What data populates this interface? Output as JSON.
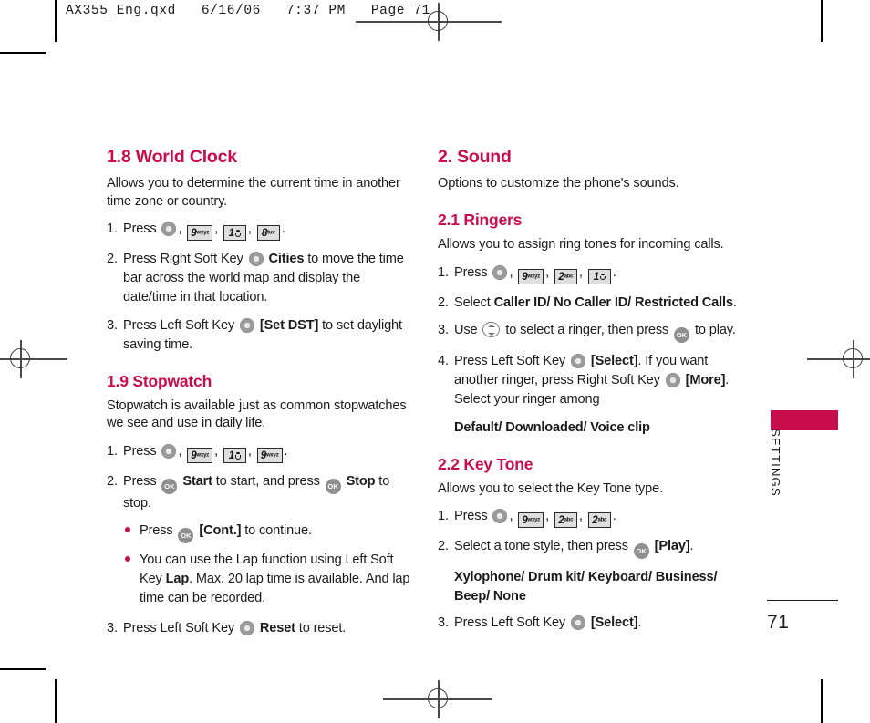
{
  "file_header": "AX355_Eng.qxd   6/16/06   7:37 PM   Page 71",
  "accent_color": "#C90C4C",
  "sidebar": {
    "tab_label": "SETTINGS",
    "page_number": "71"
  },
  "left_column": {
    "section_1_8": {
      "heading": "1.8 World Clock",
      "intro": "Allows you to determine the current time in another time zone or country.",
      "steps": [
        {
          "num": "1.",
          "pre": "Press",
          "keys": [
            "soft-key-circle",
            "9wxyz",
            "1",
            "8tuv"
          ],
          "post": "."
        },
        {
          "num": "2.",
          "pre": "Press Right Soft Key",
          "key": "soft-key-circle",
          "bold": "Cities",
          "post": "to move the time bar across the world map and display the date/time in that location."
        },
        {
          "num": "3.",
          "pre": "Press Left Soft Key",
          "key": "soft-key-circle",
          "bold": "[Set DST]",
          "post": "to set daylight saving time."
        }
      ]
    },
    "section_1_9": {
      "heading": "1.9 Stopwatch",
      "intro": "Stopwatch is available just as common stopwatches we see and use in daily life.",
      "step1": {
        "num": "1.",
        "pre": "Press",
        "post": "."
      },
      "step2": {
        "num": "2.",
        "pre": "Press",
        "bold1": "Start",
        "mid": "to start, and press",
        "bold2": "Stop",
        "post": "to stop."
      },
      "bullets": [
        {
          "pre": "Press",
          "bold": "[Cont.]",
          "post": "to continue."
        },
        {
          "pre": "You can use the Lap function using Left Soft Key",
          "bold": "Lap",
          "post": ". Max. 20 lap time is available. And lap time can be recorded."
        }
      ],
      "step3": {
        "num": "3.",
        "pre": "Press Left Soft Key",
        "bold": "Reset",
        "post": "to reset."
      }
    }
  },
  "right_column": {
    "section_2": {
      "heading": "2. Sound",
      "intro": "Options to customize the phone's sounds."
    },
    "section_2_1": {
      "heading": "2.1 Ringers",
      "intro": "Allows you to assign ring tones for incoming calls.",
      "step1": {
        "num": "1.",
        "pre": "Press",
        "post": "."
      },
      "step2": {
        "num": "2.",
        "pre": "Select",
        "bold": "Caller ID/ No Caller ID/ Restricted Calls",
        "post": "."
      },
      "step3": {
        "num": "3.",
        "pre": "Use",
        "mid": "to select a ringer, then press",
        "post": "to play."
      },
      "step4": {
        "num": "4.",
        "pre": "Press Left Soft Key",
        "bold1": "[Select]",
        "mid": ". If you want another ringer, press Right Soft Key",
        "bold2": "[More]",
        "post": ". Select your ringer among"
      },
      "options": "Default/ Downloaded/ Voice clip"
    },
    "section_2_2": {
      "heading": "2.2 Key Tone",
      "intro": "Allows you to select the Key Tone type.",
      "step1": {
        "num": "1.",
        "pre": "Press",
        "post": "."
      },
      "step2": {
        "num": "2.",
        "pre": "Select a tone style, then press",
        "bold": "[Play]",
        "post": "."
      },
      "options_line1": "Xylophone/ Drum kit/ Keyboard/ Business/",
      "options_line2": "Beep/ None",
      "step3": {
        "num": "3.",
        "pre": "Press Left Soft Key",
        "bold": "[Select]",
        "post": "."
      }
    }
  },
  "keys": {
    "nine": {
      "digit": "9",
      "letters": "wxyz"
    },
    "eight": {
      "digit": "8",
      "letters": "tuv"
    },
    "two": {
      "digit": "2",
      "letters": "abc"
    },
    "one": {
      "digit": "1",
      "letters": ""
    },
    "ok_label": "OK"
  }
}
